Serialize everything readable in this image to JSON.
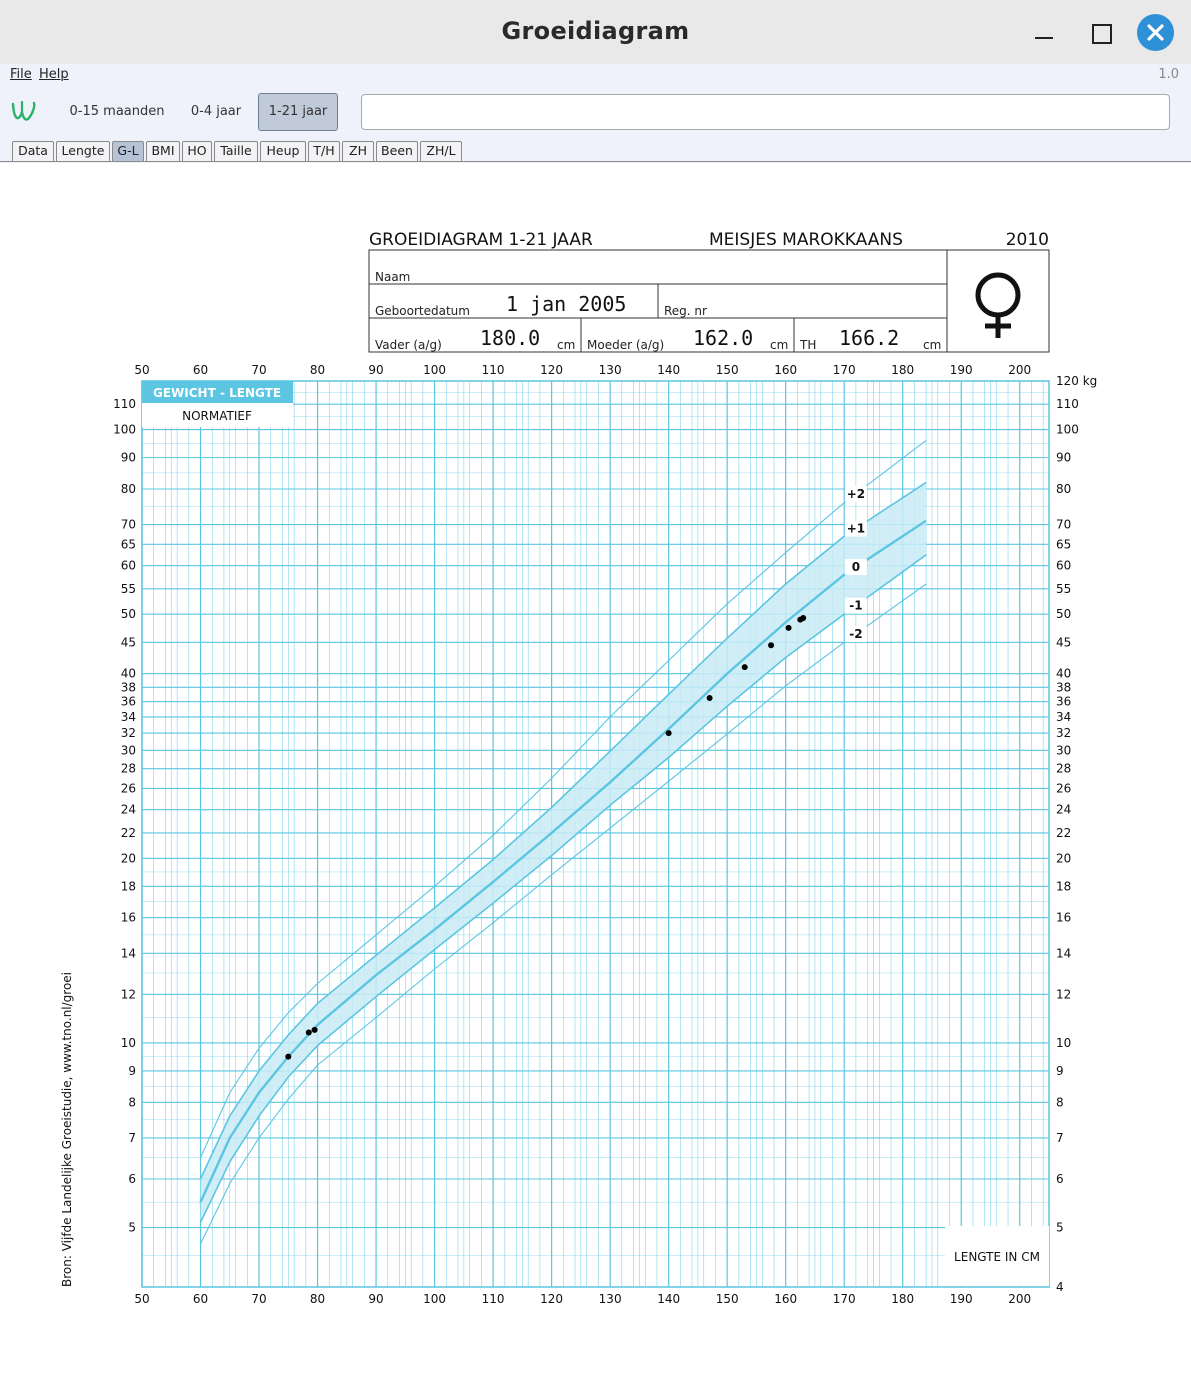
{
  "window": {
    "title": "Groeidiagram",
    "version": "1.0"
  },
  "menu": {
    "file": "File",
    "help": "Help"
  },
  "toolbar": {
    "ranges": [
      "0-15 maanden",
      "0-4 jaar",
      "1-21 jaar"
    ],
    "active_range": "1-21 jaar",
    "text_value": ""
  },
  "tabs": [
    "Data",
    "Lengte",
    "G-L",
    "BMI",
    "HO",
    "Taille",
    "Heup",
    "T/H",
    "ZH",
    "Been",
    "ZH/L"
  ],
  "active_tab": "G-L",
  "colors": {
    "accent": "#5bc5e2",
    "band": "#c9ebf6",
    "active_tab": "#b6c3d6",
    "close": "#2e90d6"
  },
  "icons": {
    "logo": "growth-logo-icon",
    "female": "female-symbol-icon"
  },
  "header": {
    "title": "GROEIDIAGRAM 1-21 JAAR",
    "group": "MEISJES  MAROKKAANS",
    "year": "2010",
    "naam_label": "Naam",
    "naam_value": "",
    "birth_label": "Geboortedatum",
    "birth_value": "1 jan 2005",
    "reg_label": "Reg. nr",
    "reg_value": "",
    "father_label": "Vader (a/g)",
    "father_value": "180.0",
    "mother_label": "Moeder (a/g)",
    "mother_value": "162.0",
    "th_label": "TH",
    "th_value": "166.2",
    "unit": "cm"
  },
  "chart_data": {
    "type": "line",
    "title": "GEWICHT - LENGTE",
    "subtitle": "NORMATIEF",
    "xlabel": "LENGTE IN CM",
    "ylabel": "kg",
    "source": "Bron: Vijfde Landelijke Groeistudie, www.tno.nl/groei",
    "xlim": [
      50,
      205
    ],
    "ylim": [
      4,
      120
    ],
    "y_scale": "log",
    "grid": true,
    "x_ticks": [
      50,
      60,
      70,
      80,
      90,
      100,
      110,
      120,
      130,
      140,
      150,
      160,
      170,
      180,
      190,
      200
    ],
    "y_ticks": [
      5,
      6,
      7,
      8,
      9,
      10,
      12,
      14,
      16,
      18,
      20,
      22,
      24,
      26,
      28,
      30,
      32,
      34,
      36,
      38,
      40,
      45,
      50,
      55,
      60,
      65,
      70,
      80,
      90,
      100,
      110
    ],
    "y_top_label": "120 kg",
    "y_bottom_label": "4",
    "x": [
      60,
      65,
      70,
      75,
      80,
      90,
      100,
      110,
      120,
      130,
      140,
      150,
      160,
      170,
      184
    ],
    "series": [
      {
        "name": "+2",
        "values": [
          6.5,
          8.3,
          9.8,
          11.2,
          12.5,
          15.0,
          18.0,
          21.8,
          27.0,
          34.0,
          42.0,
          52.0,
          63.0,
          76.0,
          96.0
        ]
      },
      {
        "name": "+1",
        "values": [
          6.0,
          7.6,
          9.0,
          10.3,
          11.6,
          13.9,
          16.6,
          19.9,
          24.2,
          29.9,
          37.0,
          45.7,
          56.0,
          67.0,
          82.0
        ]
      },
      {
        "name": "0",
        "values": [
          5.5,
          7.0,
          8.3,
          9.5,
          10.7,
          12.9,
          15.3,
          18.3,
          22.0,
          26.6,
          32.5,
          40.0,
          48.5,
          58.0,
          71.0
        ]
      },
      {
        "name": "-1",
        "values": [
          5.1,
          6.4,
          7.6,
          8.8,
          9.9,
          11.9,
          14.2,
          16.9,
          20.2,
          24.4,
          29.2,
          35.4,
          42.5,
          50.0,
          62.5
        ]
      },
      {
        "name": "-2",
        "values": [
          4.7,
          5.9,
          7.0,
          8.1,
          9.2,
          11.0,
          13.2,
          15.7,
          18.8,
          22.4,
          26.7,
          31.9,
          38.2,
          45.0,
          56.0
        ]
      }
    ],
    "measurements": [
      {
        "x": 75,
        "y": 9.5
      },
      {
        "x": 78.5,
        "y": 10.4
      },
      {
        "x": 79.5,
        "y": 10.5
      },
      {
        "x": 140,
        "y": 32
      },
      {
        "x": 147,
        "y": 36.5
      },
      {
        "x": 153,
        "y": 41
      },
      {
        "x": 157.5,
        "y": 44.5
      },
      {
        "x": 160.5,
        "y": 47.5
      },
      {
        "x": 162.5,
        "y": 49
      },
      {
        "x": 163,
        "y": 49.3
      }
    ]
  }
}
